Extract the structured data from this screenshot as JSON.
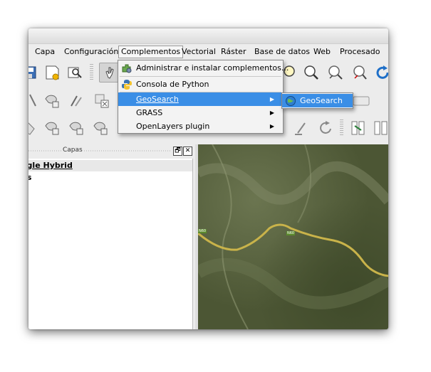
{
  "menubar": {
    "items": [
      {
        "label": "Capa"
      },
      {
        "label": "Configuración"
      },
      {
        "label": "Complementos"
      },
      {
        "label": "Vectorial"
      },
      {
        "label": "Ráster"
      },
      {
        "label": "Base de datos"
      },
      {
        "label": "Web"
      },
      {
        "label": "Procesado"
      }
    ]
  },
  "plugins_menu": {
    "items": [
      {
        "label": "Administrar e instalar complementos...",
        "icon": "puzzle-gear-icon"
      },
      {
        "label": "Consola de Python",
        "icon": "python-icon"
      },
      {
        "label": "GeoSearch",
        "has_submenu": true
      },
      {
        "label": "GRASS",
        "has_submenu": true
      },
      {
        "label": "OpenLayers plugin",
        "has_submenu": true
      }
    ],
    "highlighted": "GeoSearch"
  },
  "geosearch_submenu": {
    "items": [
      {
        "label": "GeoSearch",
        "icon": "globe-icon"
      }
    ]
  },
  "layers_panel": {
    "title": "Capas",
    "float_button": "🗗",
    "close_button": "✕",
    "layers": [
      {
        "label": "ogle Hybrid",
        "selected": true
      },
      {
        "label": "ds",
        "selected": false
      }
    ]
  },
  "map": {
    "road_labels": [
      "N60",
      "N60"
    ]
  },
  "colors": {
    "highlight": "#3a8ee6",
    "menu_bg": "#f3f3f3",
    "window_bg": "#ececec"
  }
}
